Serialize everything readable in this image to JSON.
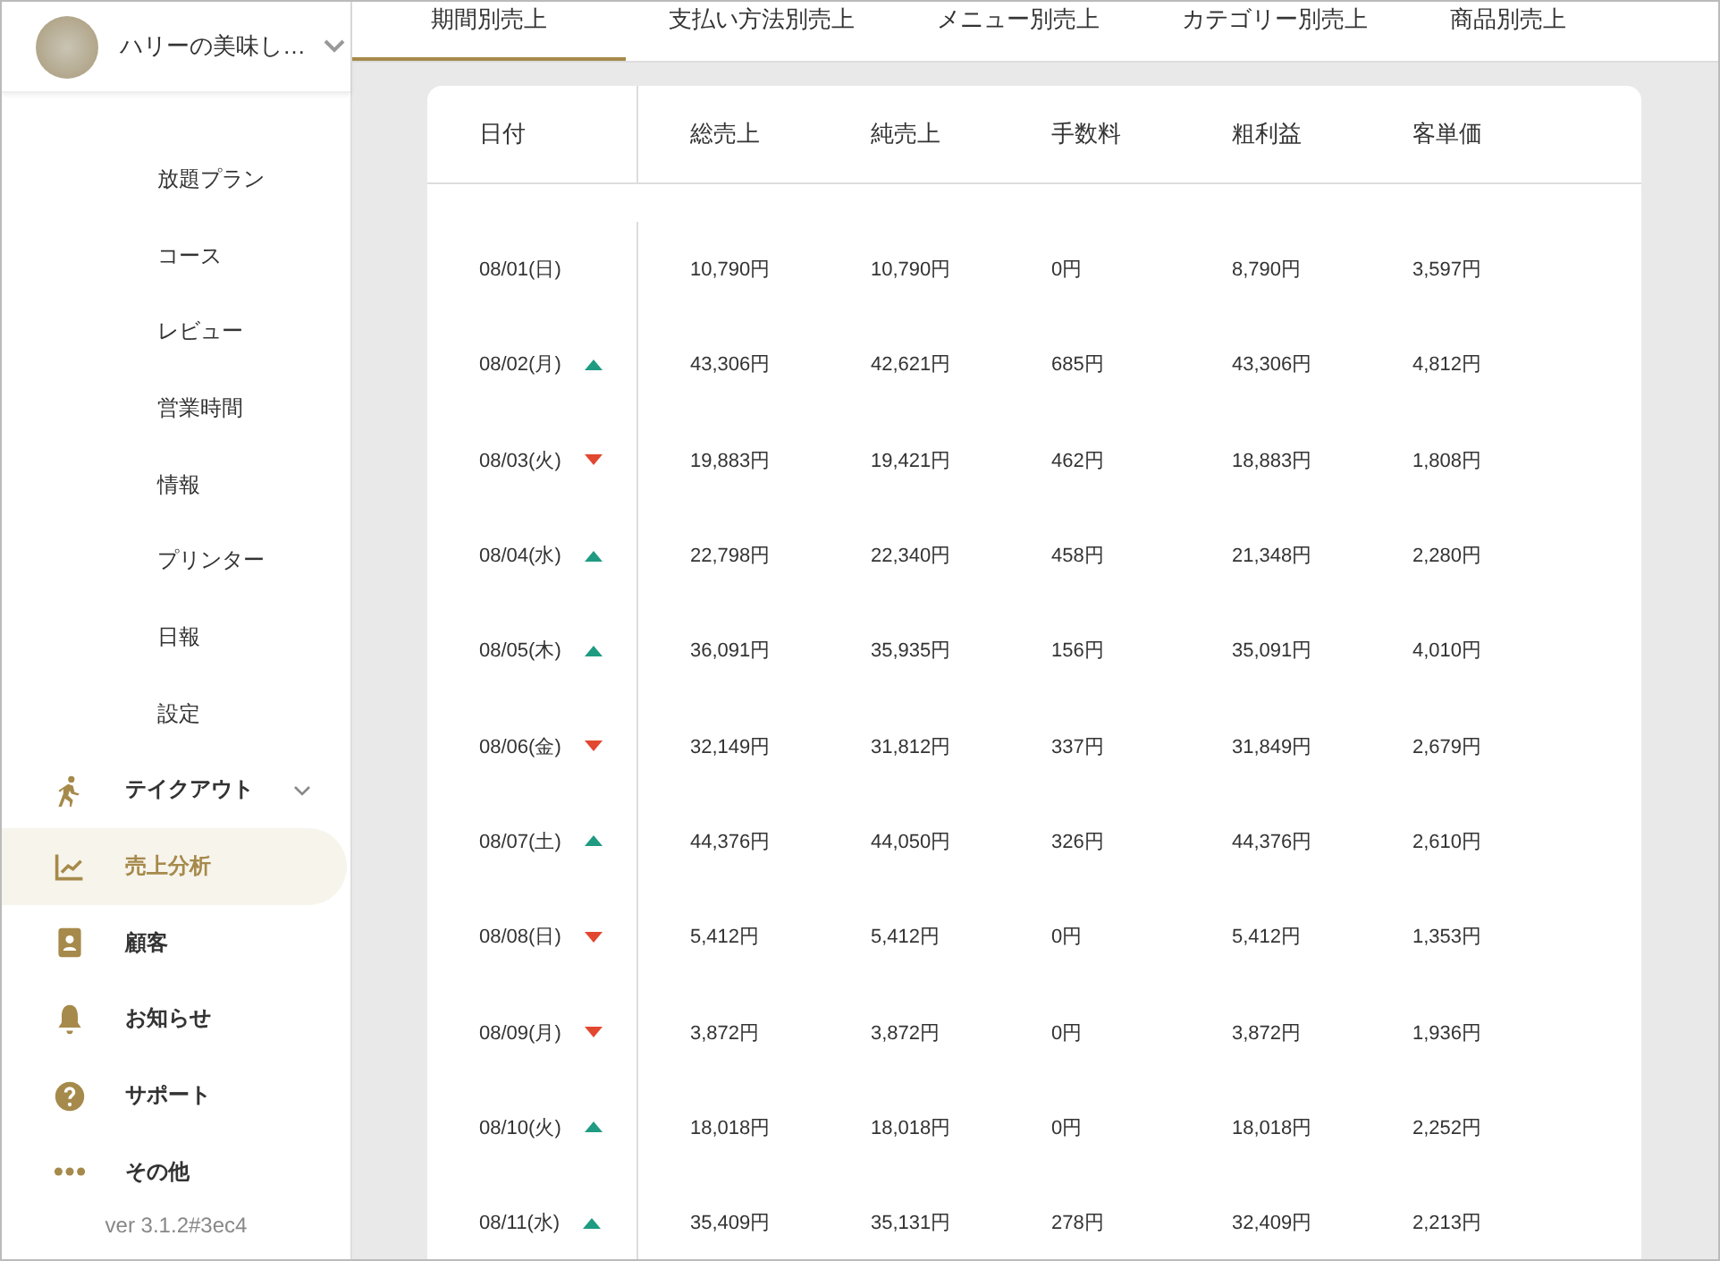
{
  "shop": {
    "name": "ハリーの美味し…"
  },
  "sidebar": {
    "sub_items": [
      "放題プラン",
      "コース",
      "レビュー",
      "営業時間",
      "情報",
      "プリンター",
      "日報",
      "設定"
    ],
    "items": [
      {
        "kind": "walk",
        "label": "テイクアウト",
        "expandable": true,
        "selected": false
      },
      {
        "kind": "chart",
        "label": "売上分析",
        "expandable": false,
        "selected": true
      },
      {
        "kind": "contact",
        "label": "顧客",
        "expandable": false,
        "selected": false
      },
      {
        "kind": "bell",
        "label": "お知らせ",
        "expandable": false,
        "selected": false
      },
      {
        "kind": "help",
        "label": "サポート",
        "expandable": false,
        "selected": false
      },
      {
        "kind": "more",
        "label": "その他",
        "expandable": false,
        "selected": false
      }
    ],
    "version": "ver 3.1.2#3ec4"
  },
  "tabs": [
    {
      "label": "期間別売上",
      "selected": true
    },
    {
      "label": "支払い方法別売上",
      "selected": false
    },
    {
      "label": "メニュー別売上",
      "selected": false
    },
    {
      "label": "カテゴリー別売上",
      "selected": false
    },
    {
      "label": "商品別売上",
      "selected": false
    }
  ],
  "table": {
    "columns": [
      "日付",
      "総売上",
      "純売上",
      "手数料",
      "粗利益",
      "客単価"
    ],
    "rows": [
      {
        "kind": "flat",
        "cells": [
          "08/01(日)",
          "10,790円",
          "10,790円",
          "0円",
          "8,790円",
          "3,597円"
        ]
      },
      {
        "kind": "up",
        "cells": [
          "08/02(月)",
          "43,306円",
          "42,621円",
          "685円",
          "43,306円",
          "4,812円"
        ]
      },
      {
        "kind": "down",
        "cells": [
          "08/03(火)",
          "19,883円",
          "19,421円",
          "462円",
          "18,883円",
          "1,808円"
        ]
      },
      {
        "kind": "up",
        "cells": [
          "08/04(水)",
          "22,798円",
          "22,340円",
          "458円",
          "21,348円",
          "2,280円"
        ]
      },
      {
        "kind": "up",
        "cells": [
          "08/05(木)",
          "36,091円",
          "35,935円",
          "156円",
          "35,091円",
          "4,010円"
        ]
      },
      {
        "kind": "down",
        "cells": [
          "08/06(金)",
          "32,149円",
          "31,812円",
          "337円",
          "31,849円",
          "2,679円"
        ]
      },
      {
        "kind": "up",
        "cells": [
          "08/07(土)",
          "44,376円",
          "44,050円",
          "326円",
          "44,376円",
          "2,610円"
        ]
      },
      {
        "kind": "down",
        "cells": [
          "08/08(日)",
          "5,412円",
          "5,412円",
          "0円",
          "5,412円",
          "1,353円"
        ]
      },
      {
        "kind": "down",
        "cells": [
          "08/09(月)",
          "3,872円",
          "3,872円",
          "0円",
          "3,872円",
          "1,936円"
        ]
      },
      {
        "kind": "up",
        "cells": [
          "08/10(火)",
          "18,018円",
          "18,018円",
          "0円",
          "18,018円",
          "2,252円"
        ]
      },
      {
        "kind": "up",
        "cells": [
          "08/11(水)",
          "35,409円",
          "35,131円",
          "278円",
          "32,409円",
          "2,213円"
        ]
      }
    ]
  }
}
